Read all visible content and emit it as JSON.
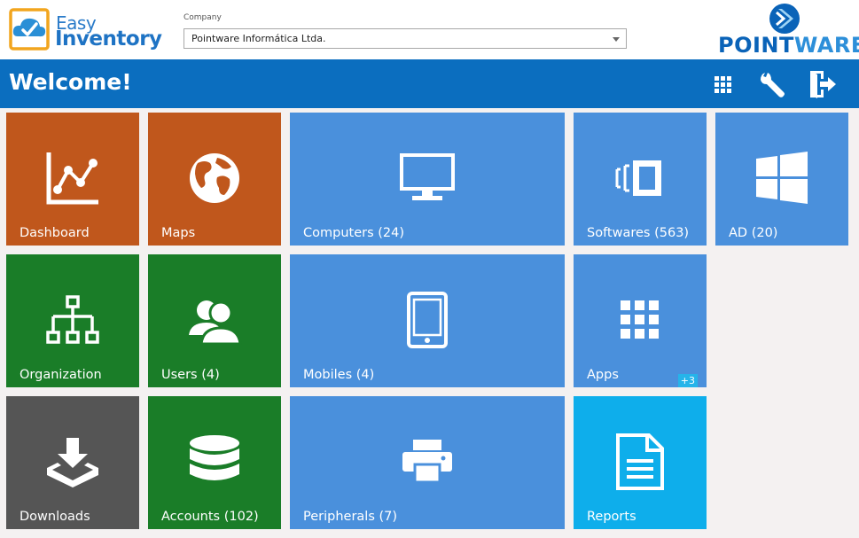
{
  "app": {
    "logo_word1": "Easy",
    "logo_word2": "Inventory"
  },
  "company": {
    "label": "Company",
    "selected": "Pointware Informática Ltda."
  },
  "brand": {
    "point": "POINT",
    "ware": "WARE"
  },
  "header": {
    "title": "Welcome!",
    "icons": [
      "apps-grid-icon",
      "wrench-icon",
      "logout-icon"
    ]
  },
  "tiles": [
    {
      "label": "Dashboard",
      "icon": "chart-line-icon",
      "color": "#c0571c"
    },
    {
      "label": "Maps",
      "icon": "globe-icon",
      "color": "#c0571c"
    },
    {
      "label": "Computers (24)",
      "icon": "monitor-icon",
      "color": "#4a90dc"
    },
    {
      "label": "Softwares (563)",
      "icon": "software-icon",
      "color": "#4a90dc"
    },
    {
      "label": "AD (20)",
      "icon": "windows-icon",
      "color": "#4a90dc"
    },
    {
      "label": "Organization",
      "icon": "org-chart-icon",
      "color": "#1a7d28"
    },
    {
      "label": "Users (4)",
      "icon": "users-icon",
      "color": "#1a7d28"
    },
    {
      "label": "Mobiles (4)",
      "icon": "tablet-icon",
      "color": "#4a90dc"
    },
    {
      "label": "Apps",
      "icon": "apps-grid-icon",
      "color": "#4a90dc",
      "badge": "+3"
    },
    {
      "label": "Downloads",
      "icon": "download-icon",
      "color": "#555555"
    },
    {
      "label": "Accounts (102)",
      "icon": "database-icon",
      "color": "#1a7d28"
    },
    {
      "label": "Peripherals (7)",
      "icon": "printer-icon",
      "color": "#4a90dc"
    },
    {
      "label": "Reports",
      "icon": "document-icon",
      "color": "#0eaeeb"
    }
  ]
}
